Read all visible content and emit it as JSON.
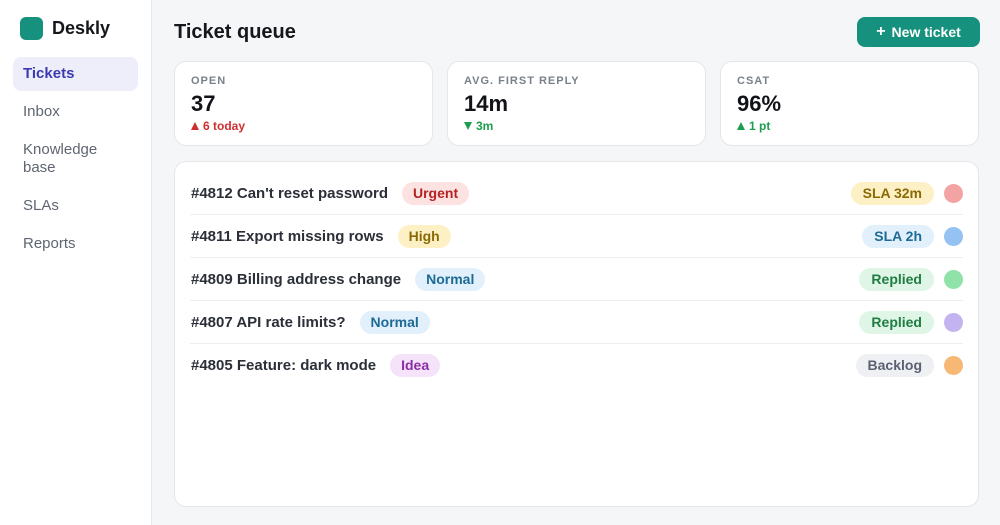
{
  "brand": {
    "name": "Deskly",
    "color": "#16917e"
  },
  "nav": [
    {
      "label": "Tickets",
      "active": true
    },
    {
      "label": "Inbox",
      "active": false
    },
    {
      "label": "Knowledge base",
      "active": false
    },
    {
      "label": "SLAs",
      "active": false
    },
    {
      "label": "Reports",
      "active": false
    }
  ],
  "header": {
    "title": "Ticket queue",
    "new_button_label": "New ticket",
    "new_button_icon": "plus-icon"
  },
  "stats": [
    {
      "label": "OPEN",
      "value": "37",
      "delta": "6 today",
      "direction": "up",
      "tone": "bad"
    },
    {
      "label": "AVG. FIRST REPLY",
      "value": "14m",
      "delta": "3m",
      "direction": "down",
      "tone": "good"
    },
    {
      "label": "CSAT",
      "value": "96%",
      "delta": "1 pt",
      "direction": "up",
      "tone": "good"
    }
  ],
  "tickets": [
    {
      "title": "#4812 Can't reset password",
      "priority": "Urgent",
      "priority_bg": "#fde2e2",
      "priority_fg": "#b42323",
      "status": "SLA 32m",
      "status_bg": "#fdf0c4",
      "status_fg": "#8a6a07",
      "avatar_color": "#f3a3a3"
    },
    {
      "title": "#4811 Export missing rows",
      "priority": "High",
      "priority_bg": "#fdf0c4",
      "priority_fg": "#8a6a07",
      "status": "SLA 2h",
      "status_bg": "#e1f0fb",
      "status_fg": "#1d6a96",
      "avatar_color": "#95c2f3"
    },
    {
      "title": "#4809 Billing address change",
      "priority": "Normal",
      "priority_bg": "#e1f0fb",
      "priority_fg": "#1d6a96",
      "status": "Replied",
      "status_bg": "#dff5e6",
      "status_fg": "#1f7d43",
      "avatar_color": "#8fe3a8"
    },
    {
      "title": "#4807 API rate limits?",
      "priority": "Normal",
      "priority_bg": "#e1f0fb",
      "priority_fg": "#1d6a96",
      "status": "Replied",
      "status_bg": "#dff5e6",
      "status_fg": "#1f7d43",
      "avatar_color": "#c3b4f1"
    },
    {
      "title": "#4805 Feature: dark mode",
      "priority": "Idea",
      "priority_bg": "#f4e3f9",
      "priority_fg": "#8a2ea6",
      "status": "Backlog",
      "status_bg": "#eef0f3",
      "status_fg": "#5a6170",
      "avatar_color": "#f7b876"
    }
  ]
}
